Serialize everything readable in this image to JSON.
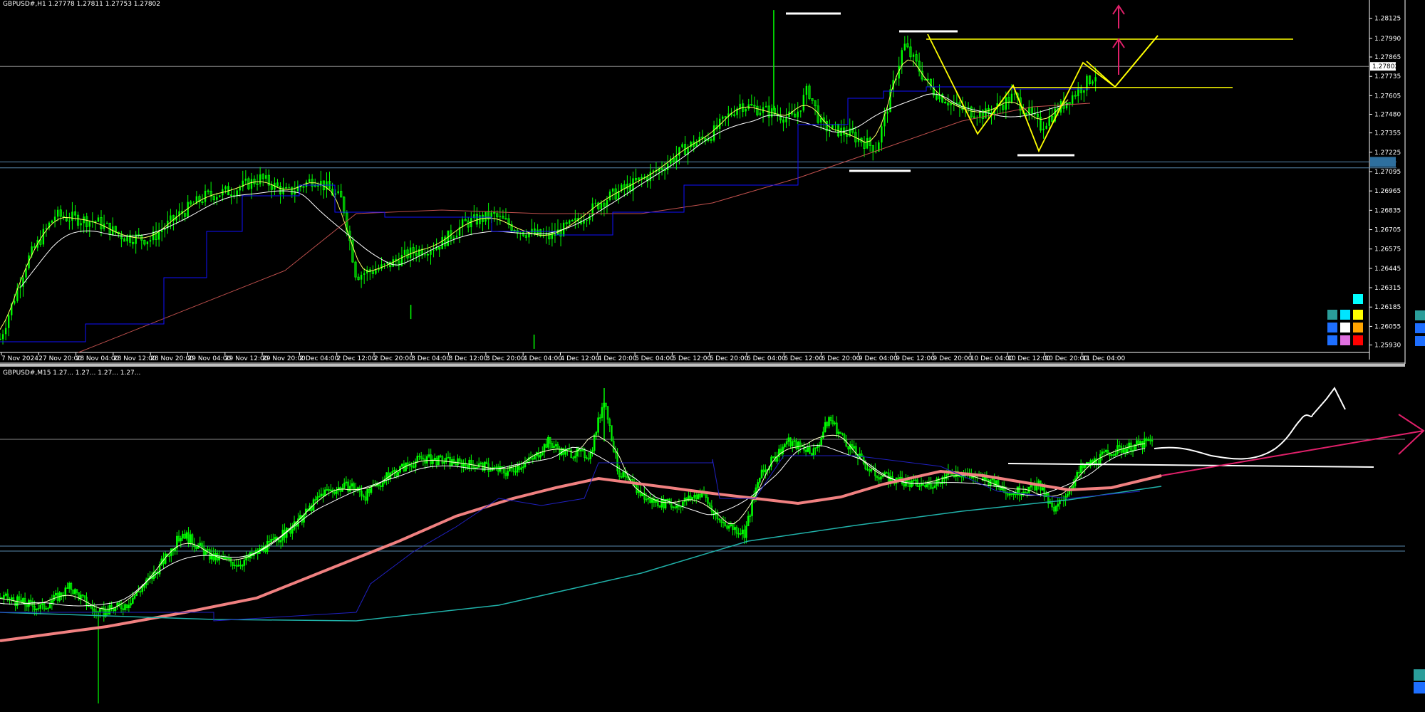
{
  "window": {
    "top_title": "GBPUSD#,H1  1.27778 1.27811 1.27753 1.27802",
    "bottom_title": "GBPUSD#,M15  1.27... 1.27... 1.27... 1.27..."
  },
  "colors": {
    "background": "#000000",
    "bull_candle": "#00ff00",
    "ma_fast": "#ffff66",
    "ma_mid": "#ffffff",
    "ma_slow_h1": "#c0504d",
    "ma_slow_m15": "#f08080",
    "ma_trend_m15": "#20b2aa",
    "kijun": "#1010ff",
    "annotation_yellow": "#ffff00",
    "annotation_pink": "#e0206a",
    "annotation_white": "#ffffff",
    "level_line": "#5a8ab0"
  },
  "chart_data": [
    {
      "type": "candlestick",
      "symbol": "GBPUSD#",
      "timeframe": "H1",
      "title": "GBPUSD#,H1  1.27778 1.27811 1.27753 1.27802",
      "ohlc_last": {
        "open": 1.27778,
        "high": 1.27811,
        "low": 1.27753,
        "close": 1.27802
      },
      "current_price_label": "1.27802",
      "ylim": [
        1.2588,
        1.282
      ],
      "y_ticks": [
        "1.28125",
        "1.27990",
        "1.27865",
        "1.27735",
        "1.27605",
        "1.27480",
        "1.27355",
        "1.27225",
        "1.27095",
        "1.26965",
        "1.26835",
        "1.26705",
        "1.26575",
        "1.26445",
        "1.26315",
        "1.26185",
        "1.26055",
        "1.25930"
      ],
      "x_ticks": [
        "7 Nov 2024",
        "27 Nov 20:00",
        "28 Nov 04:00",
        "28 Nov 12:00",
        "28 Nov 20:00",
        "29 Nov 04:00",
        "29 Nov 12:00",
        "29 Nov 20:00",
        "2 Dec 04:00",
        "2 Dec 12:00",
        "2 Dec 20:00",
        "3 Dec 04:00",
        "3 Dec 12:00",
        "3 Dec 20:00",
        "4 Dec 04:00",
        "4 Dec 12:00",
        "4 Dec 20:00",
        "5 Dec 04:00",
        "5 Dec 12:00",
        "5 Dec 20:00",
        "6 Dec 04:00",
        "6 Dec 12:00",
        "6 Dec 20:00",
        "9 Dec 04:00",
        "9 Dec 12:00",
        "9 Dec 20:00",
        "10 Dec 04:00",
        "10 Dec 12:00",
        "10 Dec 20:00",
        "11 Dec 04:00"
      ],
      "close_path": [
        [
          0,
          1.2597
        ],
        [
          0.02,
          1.265
        ],
        [
          0.04,
          1.268
        ],
        [
          0.07,
          1.2676
        ],
        [
          0.09,
          1.2666
        ],
        [
          0.11,
          1.2664
        ],
        [
          0.13,
          1.268
        ],
        [
          0.15,
          1.2693
        ],
        [
          0.17,
          1.2697
        ],
        [
          0.19,
          1.2705
        ],
        [
          0.21,
          1.2695
        ],
        [
          0.23,
          1.2705
        ],
        [
          0.25,
          1.269
        ],
        [
          0.26,
          1.264
        ],
        [
          0.28,
          1.2645
        ],
        [
          0.3,
          1.2655
        ],
        [
          0.32,
          1.266
        ],
        [
          0.34,
          1.2675
        ],
        [
          0.36,
          1.268
        ],
        [
          0.38,
          1.267
        ],
        [
          0.4,
          1.2665
        ],
        [
          0.42,
          1.2675
        ],
        [
          0.44,
          1.269
        ],
        [
          0.46,
          1.27
        ],
        [
          0.48,
          1.271
        ],
        [
          0.5,
          1.2725
        ],
        [
          0.52,
          1.2735
        ],
        [
          0.54,
          1.2755
        ],
        [
          0.56,
          1.275
        ],
        [
          0.58,
          1.2745
        ],
        [
          0.59,
          1.2765
        ],
        [
          0.6,
          1.274
        ],
        [
          0.62,
          1.2735
        ],
        [
          0.64,
          1.2725
        ],
        [
          0.66,
          1.2795
        ],
        [
          0.68,
          1.2765
        ],
        [
          0.7,
          1.2752
        ],
        [
          0.72,
          1.2748
        ],
        [
          0.74,
          1.276
        ],
        [
          0.76,
          1.274
        ],
        [
          0.78,
          1.2758
        ],
        [
          0.8,
          1.2775
        ]
      ],
      "hlines": [
        1.27802,
        1.2716,
        1.2712
      ],
      "annotations": {
        "resistance_top": 1.27985,
        "neckline": 1.2766,
        "white_bars": [
          1.2816,
          1.2803,
          1.271,
          1.2722
        ]
      },
      "color_swatches": [
        "#2a9d9a",
        "#00e5ff",
        "#ffff00",
        "#1e6fff",
        "#ffffff",
        "#ffa500",
        "#1e6fff",
        "#e070e0",
        "#ff0000",
        "#00ffff"
      ]
    },
    {
      "type": "candlestick",
      "symbol": "GBPUSD#",
      "timeframe": "M15",
      "title": "GBPUSD#,M15",
      "close_path": [
        [
          0,
          0.33
        ],
        [
          0.03,
          0.3
        ],
        [
          0.05,
          0.36
        ],
        [
          0.07,
          0.28
        ],
        [
          0.09,
          0.31
        ],
        [
          0.11,
          0.4
        ],
        [
          0.13,
          0.52
        ],
        [
          0.15,
          0.45
        ],
        [
          0.17,
          0.43
        ],
        [
          0.19,
          0.48
        ],
        [
          0.21,
          0.54
        ],
        [
          0.23,
          0.64
        ],
        [
          0.25,
          0.66
        ],
        [
          0.26,
          0.63
        ],
        [
          0.28,
          0.7
        ],
        [
          0.3,
          0.74
        ],
        [
          0.32,
          0.73
        ],
        [
          0.34,
          0.72
        ],
        [
          0.36,
          0.7
        ],
        [
          0.38,
          0.74
        ],
        [
          0.39,
          0.79
        ],
        [
          0.4,
          0.76
        ],
        [
          0.42,
          0.75
        ],
        [
          0.43,
          0.92
        ],
        [
          0.44,
          0.7
        ],
        [
          0.46,
          0.62
        ],
        [
          0.48,
          0.6
        ],
        [
          0.5,
          0.64
        ],
        [
          0.51,
          0.56
        ],
        [
          0.53,
          0.52
        ],
        [
          0.54,
          0.68
        ],
        [
          0.56,
          0.79
        ],
        [
          0.58,
          0.76
        ],
        [
          0.59,
          0.86
        ],
        [
          0.6,
          0.8
        ],
        [
          0.62,
          0.7
        ],
        [
          0.64,
          0.67
        ],
        [
          0.66,
          0.66
        ],
        [
          0.68,
          0.7
        ],
        [
          0.7,
          0.68
        ],
        [
          0.72,
          0.64
        ],
        [
          0.74,
          0.66
        ],
        [
          0.75,
          0.58
        ],
        [
          0.77,
          0.71
        ],
        [
          0.79,
          0.76
        ],
        [
          0.81,
          0.78
        ],
        [
          0.82,
          0.79
        ]
      ],
      "projection": "curve",
      "trendline": "up-right arrow"
    }
  ]
}
